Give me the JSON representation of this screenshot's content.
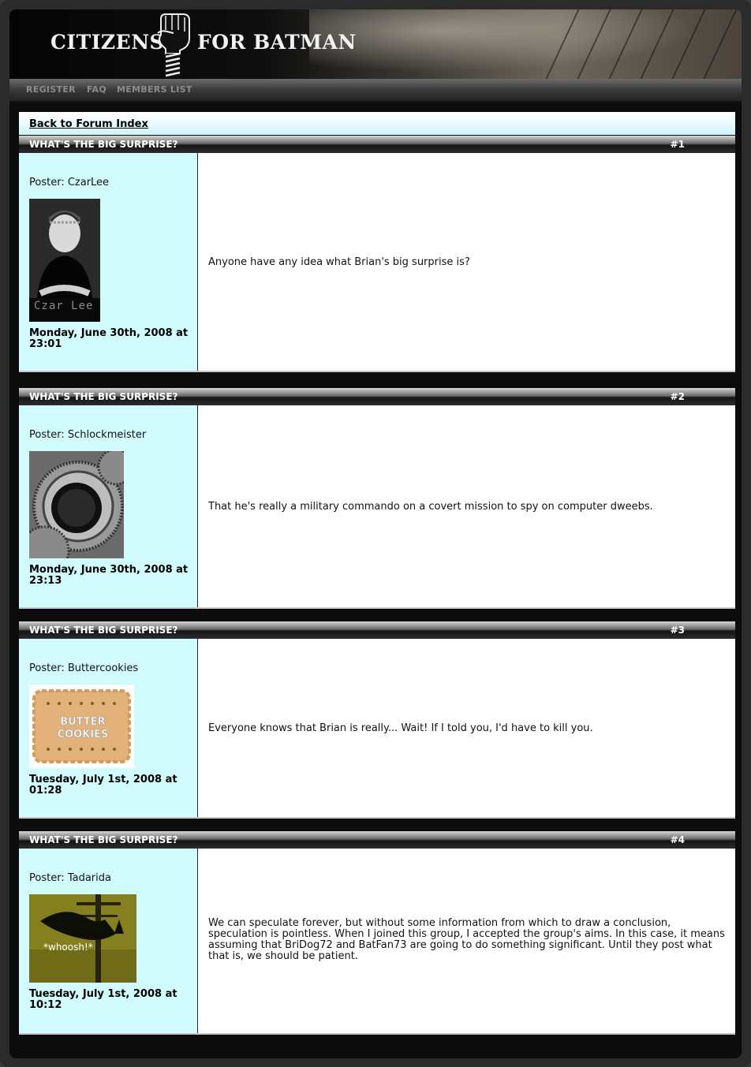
{
  "header": {
    "logo_left": "CITIZENS",
    "logo_right": "FOR BATMAN",
    "nav": [
      "REGISTER",
      "FAQ",
      "MEMBERS LIST"
    ]
  },
  "back_link": "Back to Forum Index",
  "posts": [
    {
      "title": "WHAT'S THE BIG SURPRISE?",
      "number": "#1",
      "poster": "Poster: CzarLee",
      "avatar_caption": "Czar Lee",
      "date": "Monday, June 30th, 2008 at 23:01",
      "message": "Anyone have any idea what Brian's big surprise is?"
    },
    {
      "title": "WHAT'S THE BIG SURPRISE?",
      "number": "#2",
      "poster": "Poster: Schlockmeister",
      "date": "Monday, June 30th, 2008 at 23:13",
      "message": "That he's really a military commando on a covert mission to spy on computer dweebs."
    },
    {
      "title": "WHAT'S THE BIG SURPRISE?",
      "number": "#3",
      "poster": "Poster: Buttercookies",
      "avatar_caption": "BUTTER COOKIES",
      "date": "Tuesday, July 1st, 2008 at 01:28",
      "message": "Everyone knows that Brian is really... Wait! If I told you, I'd have to kill you."
    },
    {
      "title": "WHAT'S THE BIG SURPRISE?",
      "number": "#4",
      "poster": "Poster: Tadarida",
      "avatar_caption": "*whoosh!*",
      "date": "Tuesday, July 1st, 2008 at 10:12",
      "message": "We can speculate forever, but without some information from which to draw a conclusion, speculation is pointless. When I joined this group, I accepted the group's aims. In this case, it means assuming that BriDog72 and BatFan73 are going to do something significant. Until they post what that is, we should be patient."
    }
  ],
  "colors": {
    "sidebar": "#d1fbfd",
    "page_frame": "#2b2b2b",
    "header_bar": "#1a1a1a"
  }
}
